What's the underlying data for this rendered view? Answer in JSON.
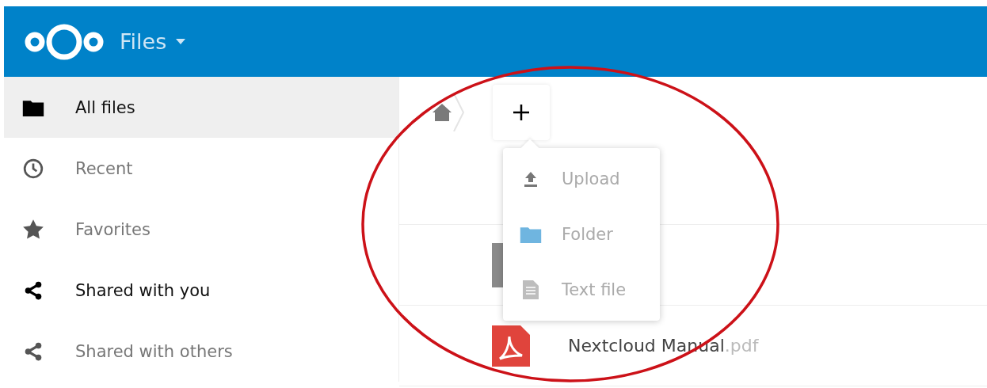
{
  "header": {
    "app_name": "Files"
  },
  "sidebar": {
    "items": [
      {
        "label": "All files",
        "kind": "folder",
        "selected": true
      },
      {
        "label": "Recent",
        "kind": "clock",
        "selected": false
      },
      {
        "label": "Favorites",
        "kind": "star",
        "selected": false
      },
      {
        "label": "Shared with you",
        "kind": "share",
        "selected": false,
        "hovered": true
      },
      {
        "label": "Shared with others",
        "kind": "share",
        "selected": false
      }
    ]
  },
  "new_menu": {
    "expanded": true,
    "items": [
      {
        "label": "Upload",
        "kind": "upload"
      },
      {
        "label": "Folder",
        "kind": "folder"
      },
      {
        "label": "Text file",
        "kind": "text"
      }
    ]
  },
  "files": [
    {
      "kind": "text"
    },
    {
      "kind": "pdf",
      "name": "Nextcloud Manual",
      "extension": ".pdf"
    }
  ]
}
